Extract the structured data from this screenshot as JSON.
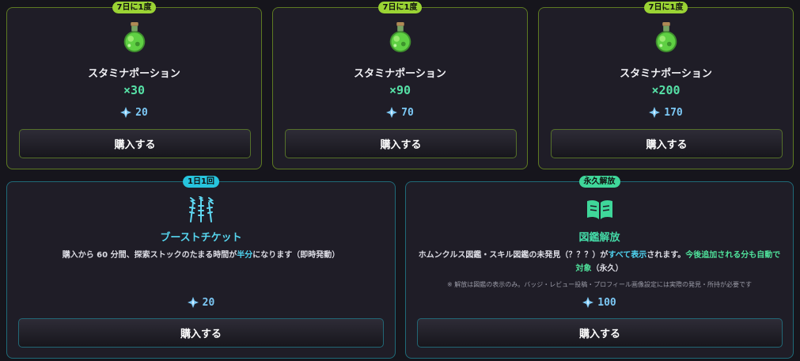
{
  "cards": [
    {
      "badge": "7日に1度",
      "name": "スタミナポーション",
      "quantity": "×30",
      "price": "20",
      "button": "購入する",
      "icon": "potion-icon"
    },
    {
      "badge": "7日に1度",
      "name": "スタミナポーション",
      "quantity": "×90",
      "price": "70",
      "button": "購入する",
      "icon": "potion-icon"
    },
    {
      "badge": "7日に1度",
      "name": "スタミナポーション",
      "quantity": "×200",
      "price": "170",
      "button": "購入する",
      "icon": "potion-icon"
    }
  ],
  "boost": {
    "badge": "1日1回",
    "name": "ブーストチケット",
    "desc_1": "購入から 60 分間、探索ストックのたまる時間が",
    "desc_hl": "半分",
    "desc_2": "になります（即時発動）",
    "price": "20",
    "button": "購入する",
    "icon": "lightning-rods-icon"
  },
  "zukan": {
    "badge": "永久解放",
    "name": "図鑑解放",
    "desc_1": "ホムンクルス図鑑・スキル図鑑の未発見（？？？）が",
    "desc_hl1": "すべて表示",
    "desc_2": "されます。",
    "desc_hl2": "今後追加される分も自動で対象",
    "desc_3": "（永久）",
    "note": "※ 解放は図鑑の表示のみ。バッジ・レビュー投稿・プロフィール画像設定には実際の発見・所持が必要です",
    "price": "100",
    "button": "購入する",
    "icon": "open-book-icon"
  },
  "colors": {
    "green_accent": "#9ad334",
    "cyan_accent": "#27c4dd",
    "teal_accent": "#3fd79a",
    "price": "#7cc8f5"
  }
}
